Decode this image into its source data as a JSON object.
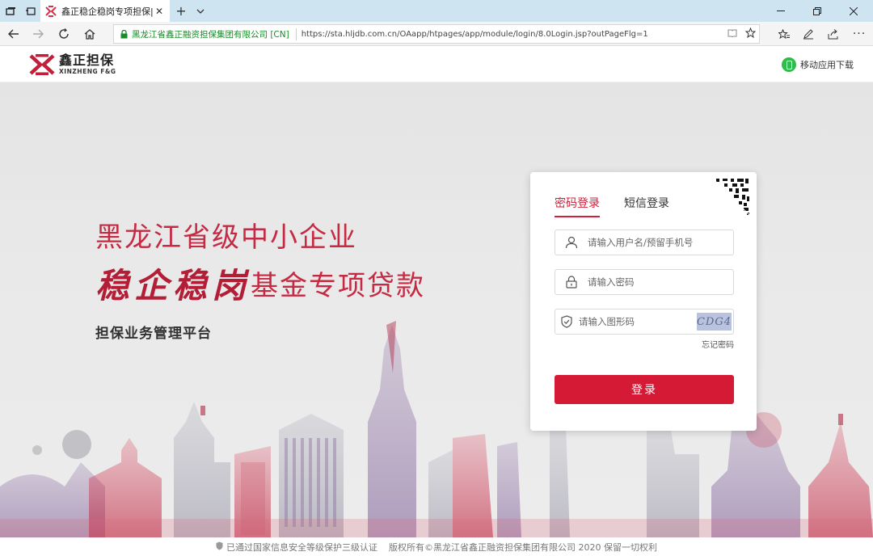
{
  "browser": {
    "tab_title": "鑫正稳企稳岗专项担保|",
    "certificate": "黑龙江省鑫正融资担保集团有限公司 [CN]",
    "url": "https://sta.hljdb.com.cn/OAapp/htpages/app/module/login/8.0Login.jsp?outPageFlg=1"
  },
  "header": {
    "logo_cn": "鑫正担保",
    "logo_en": "XINZHENG F&G",
    "mobile_download": "移动应用下载"
  },
  "hero": {
    "line1": "黑龙江省级中小企业",
    "line2_bold": "稳企稳岗",
    "line2_rest": "基金专项贷款",
    "subtitle": "担保业务管理平台"
  },
  "login": {
    "tab_password": "密码登录",
    "tab_sms": "短信登录",
    "username_placeholder": "请输入用户名/预留手机号",
    "password_placeholder": "请输入密码",
    "captcha_placeholder": "请输入图形码",
    "captcha_text": "CDG4",
    "forgot_password": "忘记密码",
    "submit": "登录"
  },
  "footer": {
    "security": "已通过国家信息安全等级保护三级认证",
    "copyright": "版权所有©黑龙江省鑫正融资担保集团有限公司 2020 保留一切权利"
  },
  "colors": {
    "brand_red": "#d41a34",
    "secure_green": "#1a8a2a",
    "tabstrip_blue": "#cfe4f1"
  }
}
